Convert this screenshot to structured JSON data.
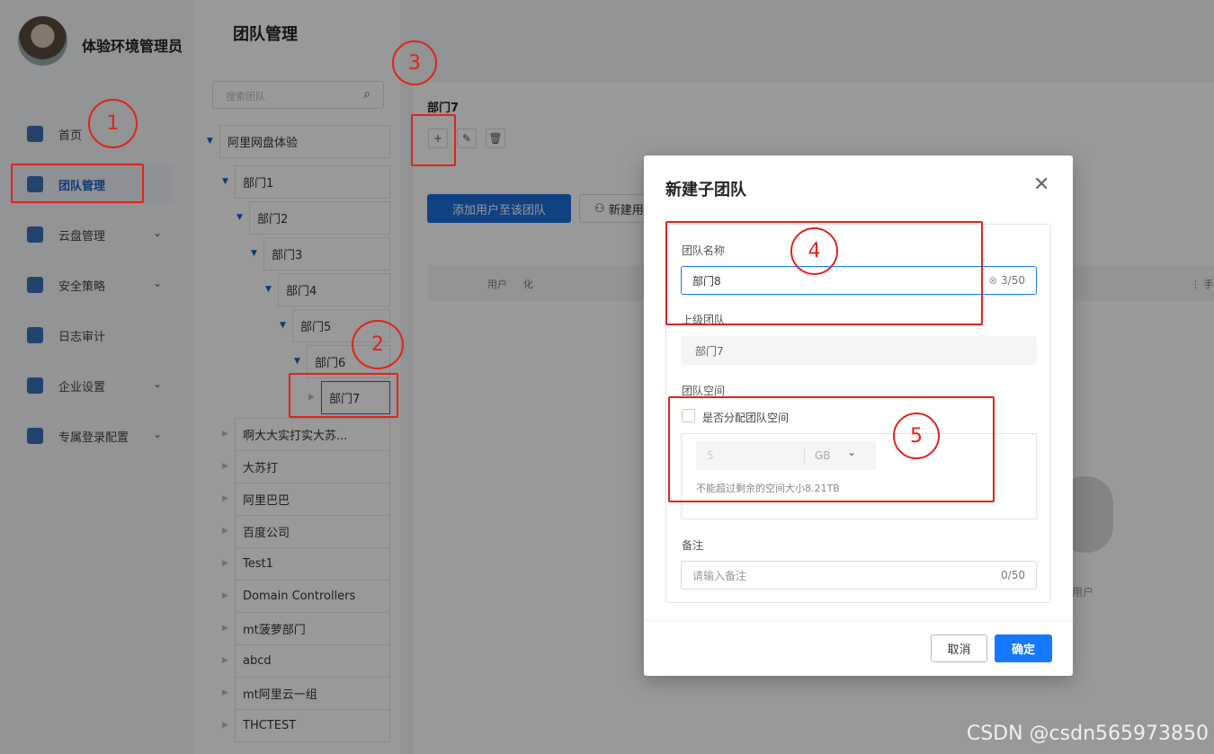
{
  "user": {
    "name": "体验环境管理员"
  },
  "nav": [
    {
      "label": "首页",
      "icon": "home-icon"
    },
    {
      "label": "团队管理",
      "icon": "user-icon",
      "active": true
    },
    {
      "label": "云盘管理",
      "icon": "drive-icon",
      "expandable": true
    },
    {
      "label": "安全策略",
      "icon": "shield-icon",
      "expandable": true
    },
    {
      "label": "日志审计",
      "icon": "log-icon"
    },
    {
      "label": "企业设置",
      "icon": "gear-icon",
      "expandable": true
    },
    {
      "label": "专属登录配置",
      "icon": "sliders-icon",
      "expandable": true
    }
  ],
  "page_title": "团队管理",
  "search": {
    "placeholder": "搜索团队"
  },
  "tree": {
    "root": "阿里网盘体验",
    "nested": [
      "部门1",
      "部门2",
      "部门3",
      "部门4",
      "部门5",
      "部门6",
      "部门7"
    ],
    "others": [
      "啊大大实打实大苏...",
      "大苏打",
      "阿里巴巴",
      "百度公司",
      "Test1",
      "Domain Controllers",
      "mt菠萝部门",
      "abcd",
      "mt阿里云一组",
      "THCTEST"
    ]
  },
  "detail": {
    "team_name": "部门7",
    "add_users_button": "添加用户至该团队",
    "new_user_button": "新建用",
    "table_headers": [
      "用户",
      "化",
      "手"
    ],
    "empty_text": "用户"
  },
  "modal": {
    "title": "新建子团队",
    "name_label": "团队名称",
    "name_value": "部门8",
    "name_count": "3/50",
    "parent_label": "上级团队",
    "parent_value": "部门7",
    "space_label": "团队空间",
    "space_checkbox": "是否分配团队空间",
    "space_checked": false,
    "space_value": "5",
    "space_unit": "GB",
    "space_hint": "不能超过剩余的空间大小8.21TB",
    "note_label": "备注",
    "note_placeholder": "请输入备注",
    "note_count": "0/50",
    "cancel": "取消",
    "ok": "确定"
  },
  "annotations": [
    "1",
    "2",
    "3",
    "4",
    "5"
  ],
  "watermark": "CSDN @csdn565973850",
  "colors": {
    "primary": "#1677ff",
    "annotation": "#e0241b"
  }
}
